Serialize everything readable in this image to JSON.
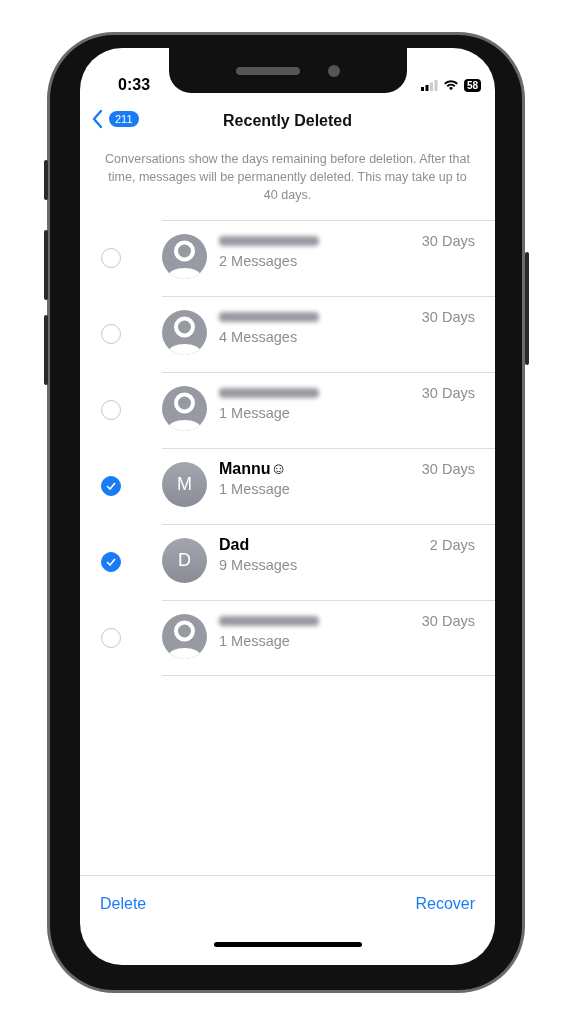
{
  "status_bar": {
    "time": "0:33",
    "battery": "58"
  },
  "nav": {
    "back_badge": "211",
    "title": "Recently Deleted"
  },
  "description": "Conversations show the days remaining before deletion. After that time, messages will be permanently deleted. This may take up to 40 days.",
  "conversations": [
    {
      "kind": "blurred",
      "subtitle": "2 Messages",
      "remaining": "30 Days",
      "selected": false
    },
    {
      "kind": "blurred",
      "subtitle": "4 Messages",
      "remaining": "30 Days",
      "selected": false
    },
    {
      "kind": "blurred",
      "subtitle": "1 Message",
      "remaining": "30 Days",
      "selected": false
    },
    {
      "kind": "contact",
      "name": "Mannu☺",
      "initial": "M",
      "subtitle": "1 Message",
      "remaining": "30 Days",
      "selected": true
    },
    {
      "kind": "contact",
      "name": "Dad",
      "initial": "D",
      "subtitle": "9 Messages",
      "remaining": "2 Days",
      "selected": true
    },
    {
      "kind": "blurred",
      "subtitle": "1 Message",
      "remaining": "30 Days",
      "selected": false
    }
  ],
  "toolbar": {
    "actions": [
      "Delete",
      "Recover"
    ]
  }
}
